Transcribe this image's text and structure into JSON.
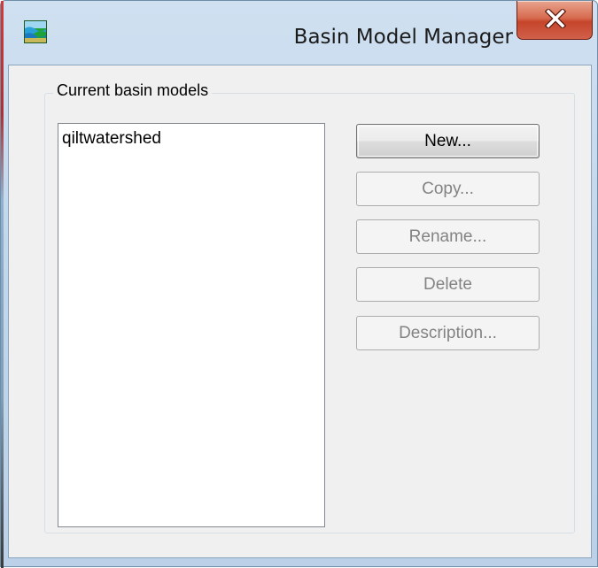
{
  "window": {
    "title": "Basin Model Manager",
    "icon": "watershed-app-icon",
    "close_icon": "close-icon"
  },
  "group": {
    "label": "Current basin models"
  },
  "basin_models": {
    "items": [
      "qiltwatershed"
    ]
  },
  "buttons": {
    "new_label": "New...",
    "copy_label": "Copy...",
    "rename_label": "Rename...",
    "delete_label": "Delete",
    "description_label": "Description..."
  },
  "colors": {
    "close_button": "#c5452b",
    "titlebar": "#c3d6ea",
    "disabled_text": "#838383"
  }
}
